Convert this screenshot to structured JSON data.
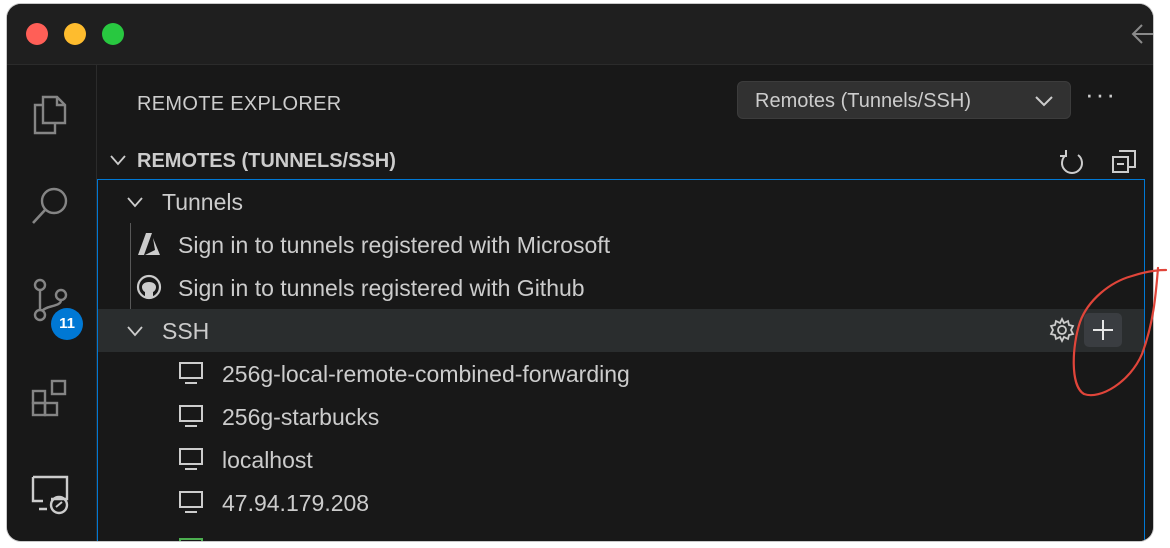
{
  "window": {
    "traffic_lights": [
      "close",
      "minimize",
      "zoom"
    ]
  },
  "activity_bar": {
    "items": [
      {
        "name": "explorer",
        "icon": "files-icon"
      },
      {
        "name": "search",
        "icon": "search-icon"
      },
      {
        "name": "source-control",
        "icon": "source-control-icon",
        "badge": "11"
      },
      {
        "name": "extensions",
        "icon": "extensions-icon"
      },
      {
        "name": "remote-explorer",
        "icon": "remote-explorer-icon"
      }
    ]
  },
  "sidebar": {
    "title": "REMOTE EXPLORER",
    "dropdown": {
      "value": "Remotes (Tunnels/SSH)"
    },
    "more_actions": "···",
    "section": {
      "label": "REMOTES (TUNNELS/SSH)",
      "actions": [
        "refresh-icon",
        "collapse-all-icon"
      ]
    },
    "tree": {
      "tunnels_label": "Tunnels",
      "tunnel_items": [
        {
          "label": "Sign in to tunnels registered with Microsoft",
          "icon": "azure-icon"
        },
        {
          "label": "Sign in to tunnels registered with Github",
          "icon": "github-icon"
        }
      ],
      "ssh_label": "SSH",
      "ssh_actions": [
        "gear-icon",
        "plus-icon"
      ],
      "ssh_hosts": [
        "256g-local-remote-combined-forwarding",
        "256g-starbucks",
        "localhost",
        "47.94.179.208"
      ]
    }
  },
  "colors": {
    "background": "#181818",
    "text": "#cccccc",
    "accent": "#0078d4",
    "selected_row": "#2a2d2e",
    "annotation": "#e0453a"
  }
}
